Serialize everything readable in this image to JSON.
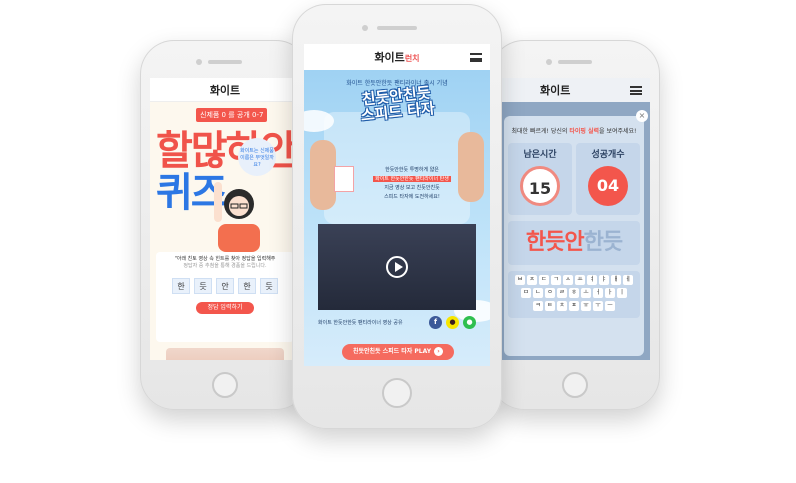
{
  "left_phone": {
    "logo": "화이트",
    "badge": "신제품 0 를 공개 0-7",
    "quiz_line1": "할많하안",
    "quiz_line2": "퀴즈",
    "bubble": "화이트는 신제품 이름은 무엇일까요?",
    "card_text": "\"아래 친토 영상 속 힌트를 찾아 정답을 입력해주",
    "card_sub": "정답자 중 추첨을 통해 경품을 드립니다.",
    "tiles": [
      "한",
      "듯",
      "안",
      "한",
      "듯"
    ],
    "submit_button": "정답 입력하기"
  },
  "center_phone": {
    "logo": "화이트",
    "logo_tag": "런치",
    "subtitle": "화이트 한듯안한듯 팬티라이너 출시 기념",
    "title_line1": "친듯안친듯",
    "title_line2": "스피드 타자",
    "desc_line1": "한듯안한듯 투명하게 얇은",
    "desc_highlight": "화이트 한듯안한듯 팬티라이너 탄생",
    "desc_line3": "지금 영상 보고 친듯안친듯",
    "desc_line4": "스피드 타자에 도전하세요!",
    "share_text": "화이트 한듯안한듯 팬티라이너 영상 공유",
    "share_icons": [
      "facebook-icon",
      "kakao-icon",
      "line-icon"
    ],
    "play_button": "친듯안친듯 스피드 타자 PLAY"
  },
  "right_phone": {
    "logo": "화이트",
    "close": "×",
    "instruction_pre": "최대한 빠르게! 당신의 ",
    "instruction_em": "타이핑 실력",
    "instruction_post": "을 보여주세요!",
    "time_label": "남은시간",
    "time_value": "15",
    "success_label": "성공개수",
    "success_value": "04",
    "word_typed": "한듯안",
    "word_remaining": "한듯",
    "keyboard_rows": [
      [
        "ㅂ",
        "ㅈ",
        "ㄷ",
        "ㄱ",
        "ㅅ",
        "ㅛ",
        "ㅕ",
        "ㅑ",
        "ㅐ",
        "ㅔ"
      ],
      [
        "ㅁ",
        "ㄴ",
        "ㅇ",
        "ㄹ",
        "ㅎ",
        "ㅗ",
        "ㅓ",
        "ㅏ",
        "ㅣ"
      ],
      [
        "ㅋ",
        "ㅌ",
        "ㅊ",
        "ㅍ",
        "ㅠ",
        "ㅜ",
        "ㅡ"
      ]
    ]
  }
}
